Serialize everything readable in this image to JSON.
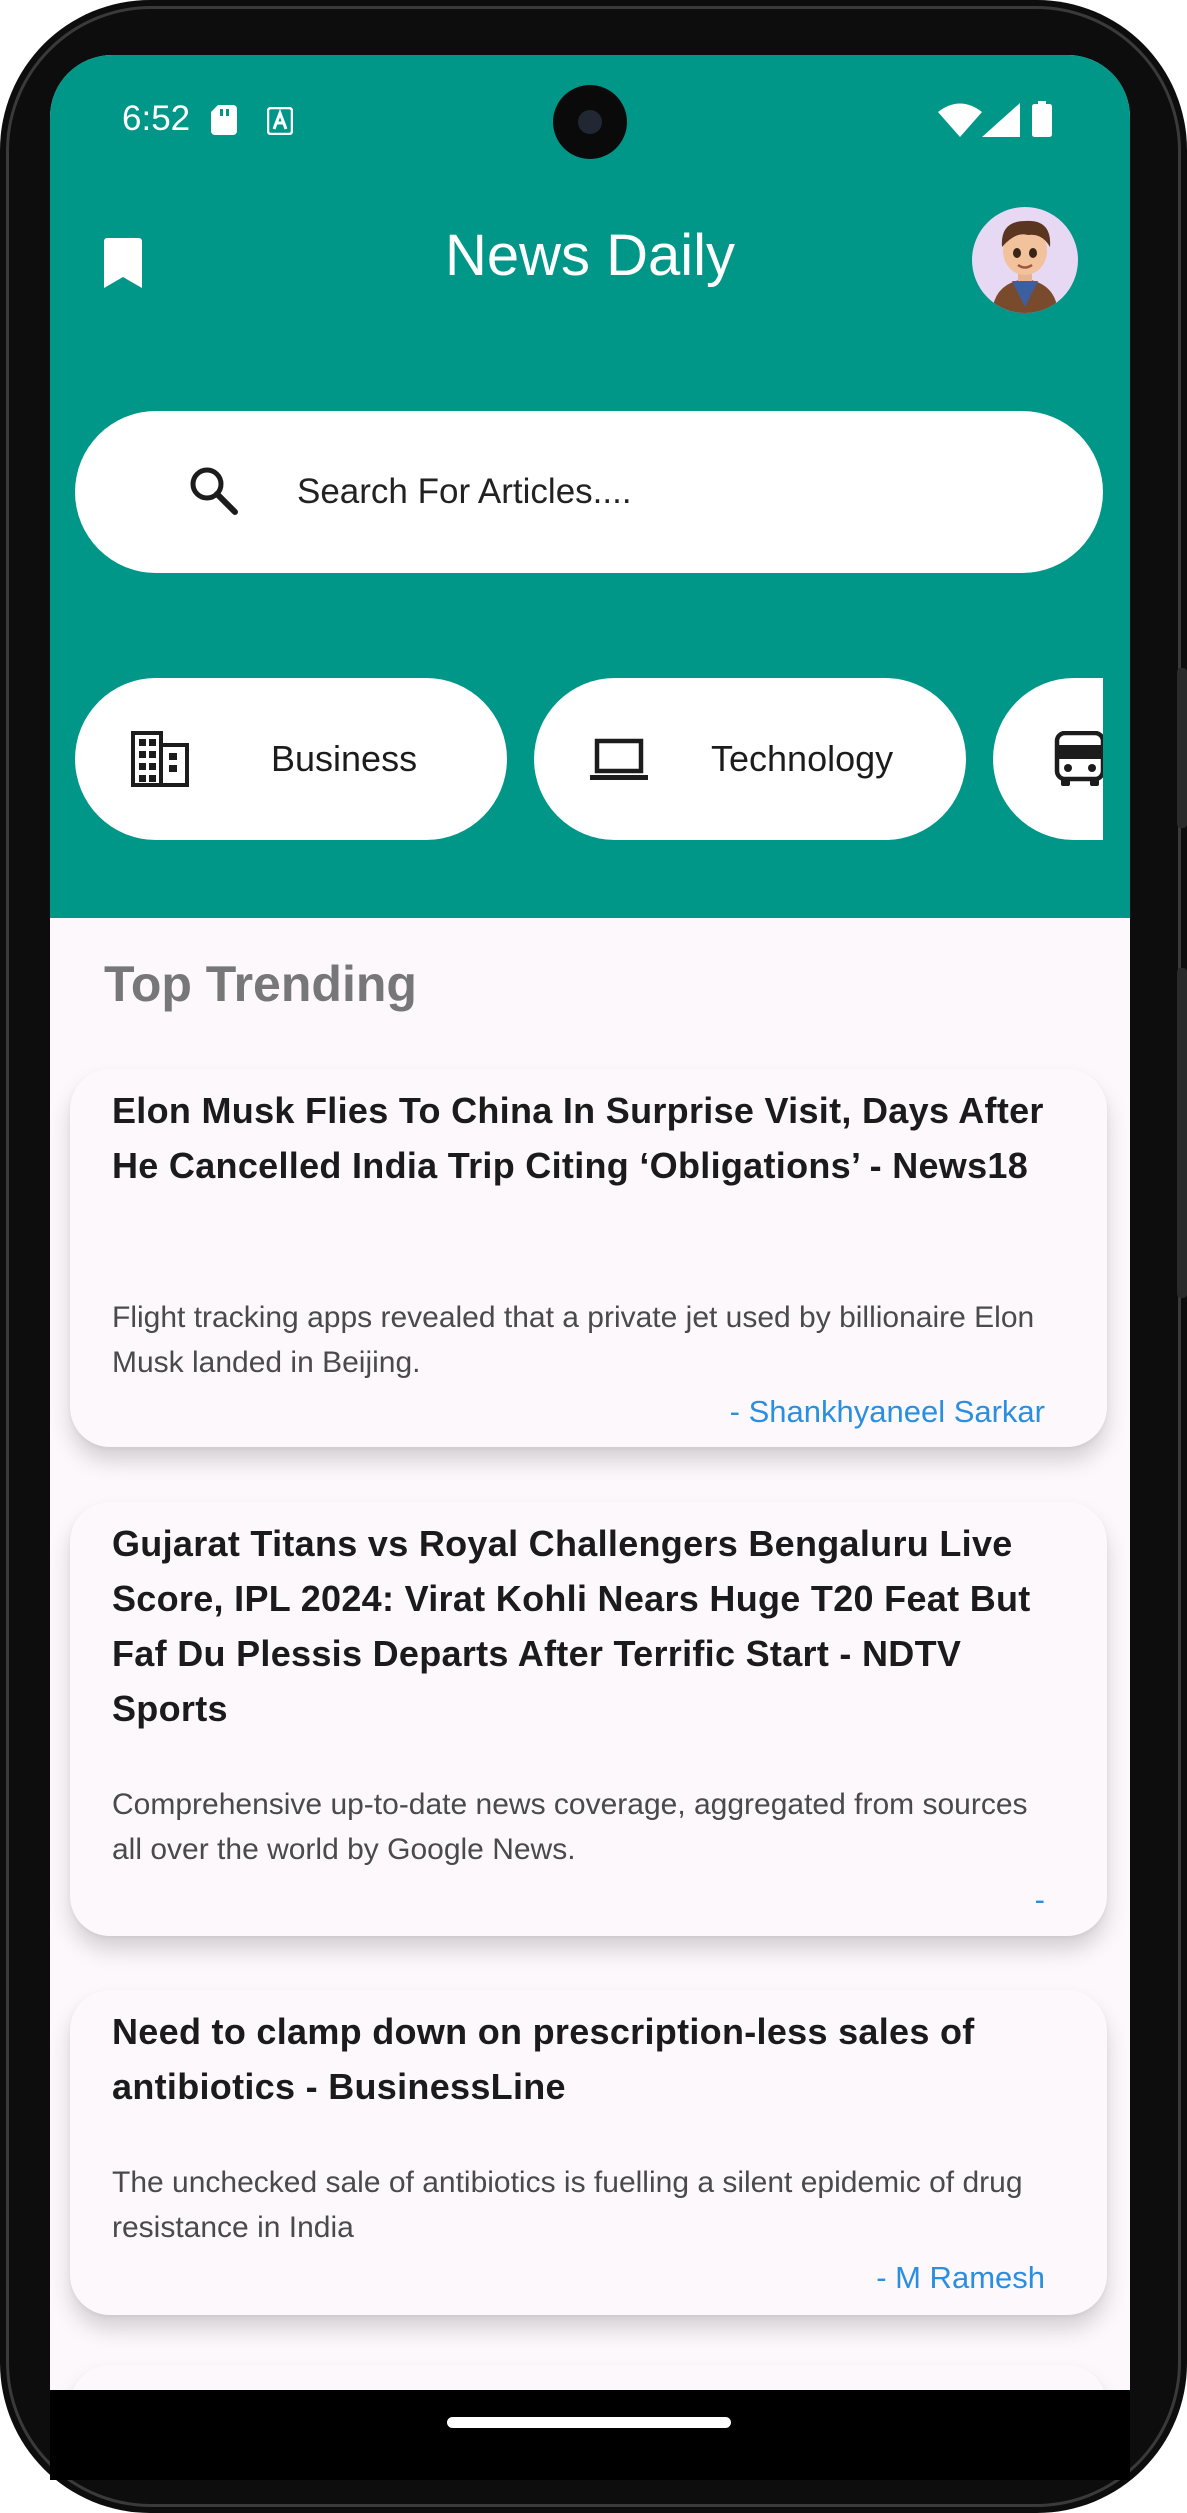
{
  "status_bar": {
    "time": "6:52"
  },
  "app": {
    "title": "News Daily"
  },
  "search": {
    "placeholder": "Search For Articles...."
  },
  "categories": [
    {
      "label": "Business",
      "icon": "building-icon"
    },
    {
      "label": "Technology",
      "icon": "laptop-icon"
    },
    {
      "label": "",
      "icon": "bus-icon"
    }
  ],
  "section": {
    "title": "Top Trending"
  },
  "articles": [
    {
      "title": "Elon Musk Flies To China In Surprise Visit, Days After He Cancelled India Trip Citing ‘Obligations’ - News18",
      "description": "Flight tracking apps revealed that a private jet used by billionaire Elon Musk landed in Beijing.",
      "author": "- Shankhyaneel Sarkar"
    },
    {
      "title": "Gujarat Titans vs Royal Challengers Bengaluru Live Score, IPL 2024: Virat Kohli Nears Huge T20 Feat But Faf Du Plessis Departs After Terrific Start - NDTV Sports",
      "description": "Comprehensive up-to-date news coverage, aggregated from sources all over the world by Google News.",
      "author": "-"
    },
    {
      "title": "Need to clamp down on prescription-less sales of antibiotics - BusinessLine",
      "description": "The unchecked sale of antibiotics is fuelling a silent epidemic of drug resistance in India",
      "author": "- M Ramesh"
    }
  ],
  "colors": {
    "header": "#009688",
    "background": "#fcf8fc",
    "author_link": "#2a8fe0",
    "section_title": "#777777"
  }
}
